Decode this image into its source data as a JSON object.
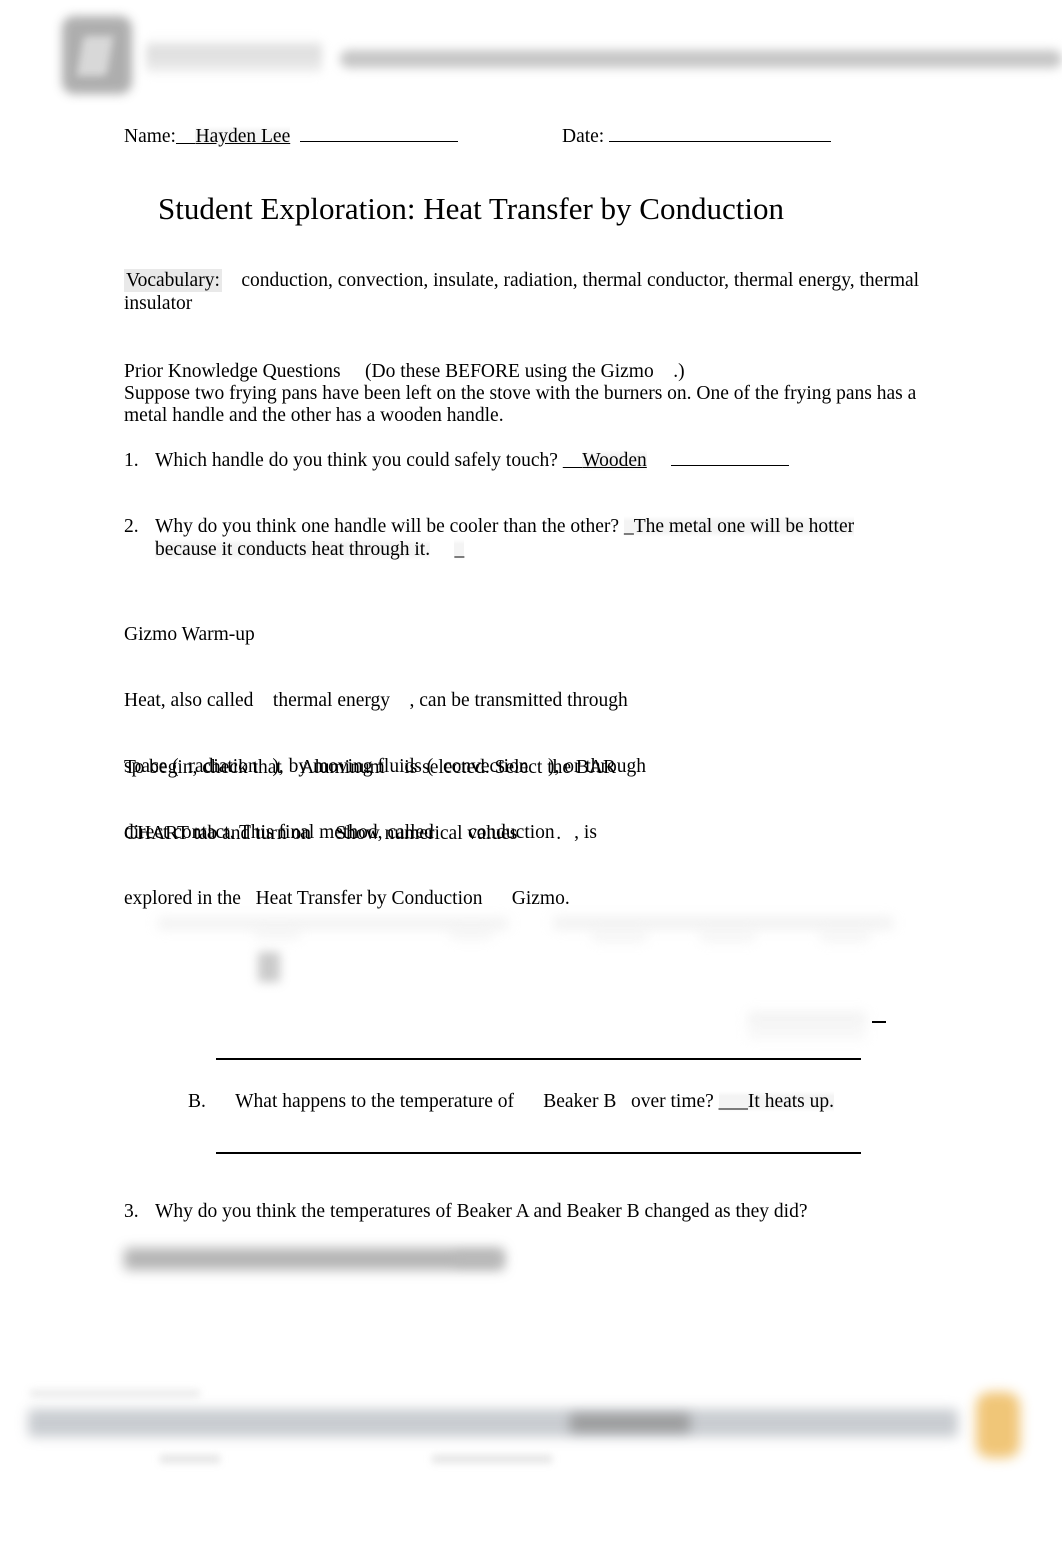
{
  "document": {
    "name_label": "Name:",
    "name_value": "Hayden Lee",
    "date_label": "Date:",
    "date_value": "",
    "title": "Student Exploration: Heat Transfer by Conduction"
  },
  "vocabulary": {
    "label": "Vocabulary:",
    "terms": "conduction, convection, insulate, radiation, thermal conductor, thermal energy, thermal insulator"
  },
  "prior_knowledge": {
    "heading": "Prior Knowledge Questions",
    "heading_note": "(Do these BEFORE using the Gizmo",
    "heading_note_tail": ".)",
    "intro": "Suppose two frying pans have been left on the stove with the burners on. One of the frying pans has a metal handle and the other has a wooden handle."
  },
  "questions": [
    {
      "number": "1.",
      "text": "Which handle do you think you could safely touch?",
      "answer": "Wooden"
    },
    {
      "number": "2.",
      "text": "Why do you think one handle will be cooler than the other?",
      "answer_line1": "_The metal one will be hotter",
      "answer_line2": "because it conducts heat through it.",
      "answer_tail": "_"
    },
    {
      "number": "3.",
      "text": "Why do you think the temperatures of      Beaker A    and  Beaker B    changed as they did?",
      "answer": ""
    }
  ],
  "warmup": {
    "heading": "Gizmo Warm-up",
    "line1": "Heat, also called    thermal energy    , can be transmitted through",
    "line2": "space (  radiation   ), by moving fluids (  convection    ), or through",
    "line3": "direct contact. This final method, called       conduction    , is",
    "line4": "explored in the   Heat Transfer by Conduction      Gizmo.",
    "instruction_line1": "To begin, check that    Aluminum    is selected. Select the BAR",
    "instruction_line2": "CHART tab and turn on     Show numerical values        ."
  },
  "part_b": {
    "letter": "B.",
    "text": "What happens to the temperature of      Beaker B   over time?",
    "answer": "___It heats up."
  },
  "branding": {
    "logo_name": "gizmos-logo-icon",
    "wordmark": "",
    "header_bar": ""
  },
  "footer": {
    "text": "",
    "badge": ""
  },
  "colors": {
    "page_background": "#ffffff",
    "text": "#000000",
    "highlight": "#e9e9e9",
    "answer_shade": "#f3f3f3",
    "blur_gray": "#c6c6c6",
    "footer_badge": "#f0c371",
    "rule": "#000000"
  }
}
